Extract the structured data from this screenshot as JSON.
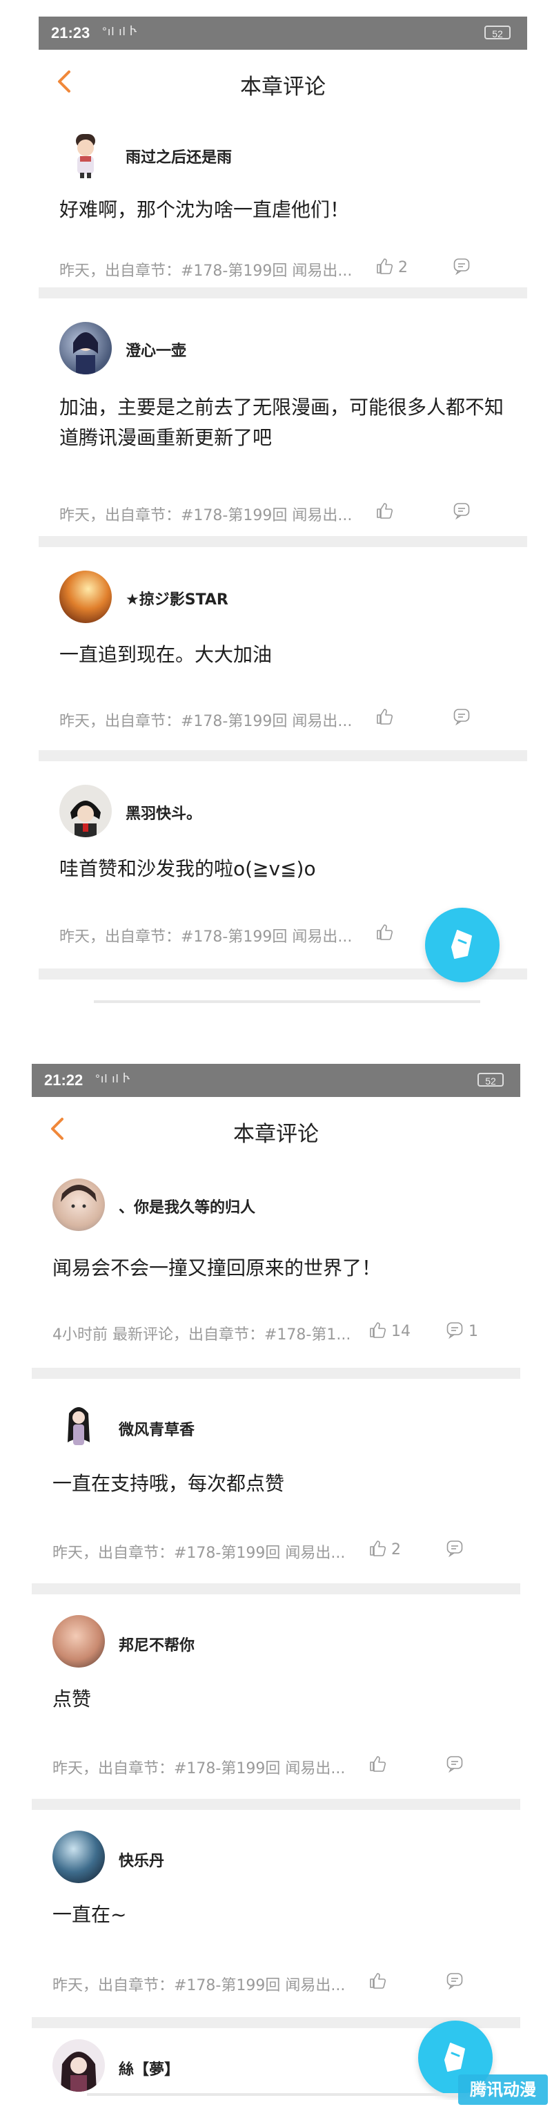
{
  "screens": [
    {
      "status": {
        "time": "21:23",
        "signal": "°ıl ıl Ⴡ",
        "battery": "52"
      },
      "header": {
        "title": "本章评论"
      },
      "comments": [
        {
          "user": "雨过之后还是雨",
          "text": "好难啊，那个沈为啥一直虐他们！",
          "meta": "昨天，出自章节：#178-第199回 闻易出...",
          "likes": "2",
          "replies": ""
        },
        {
          "user": "澄心一壶",
          "text": "加油，主要是之前去了无限漫画，可能很多人都不知道腾讯漫画重新更新了吧",
          "meta": "昨天，出自章节：#178-第199回 闻易出...",
          "likes": "",
          "replies": ""
        },
        {
          "user": "★掠ジ影STAR",
          "text": "一直追到现在。大大加油",
          "meta": "昨天，出自章节：#178-第199回 闻易出...",
          "likes": "",
          "replies": ""
        },
        {
          "user": "黑羽快斗。",
          "text": "哇首赞和沙发我的啦o(≧v≦)o",
          "meta": "昨天，出自章节：#178-第199回 闻易出...",
          "likes": "",
          "replies": ""
        }
      ]
    },
    {
      "status": {
        "time": "21:22",
        "signal": "°ıl ıl Ⴡ",
        "battery": "52"
      },
      "header": {
        "title": "本章评论"
      },
      "comments": [
        {
          "user": "、你是我久等的归人",
          "text": "闻易会不会一撞又撞回原来的世界了！",
          "meta": "4小时前 最新评论，出自章节：#178-第1...",
          "likes": "14",
          "replies": "1"
        },
        {
          "user": "微风青草香",
          "text": "一直在支持哦，每次都点赞",
          "meta": "昨天，出自章节：#178-第199回 闻易出...",
          "likes": "2",
          "replies": ""
        },
        {
          "user": "邦尼不帮你",
          "text": "点赞",
          "meta": "昨天，出自章节：#178-第199回 闻易出...",
          "likes": "",
          "replies": ""
        },
        {
          "user": "快乐丹",
          "text": "一直在~",
          "meta": "昨天，出自章节：#178-第199回 闻易出...",
          "likes": "",
          "replies": ""
        },
        {
          "user": "絲【夢】",
          "text": "",
          "meta": "",
          "likes": "",
          "replies": ""
        }
      ]
    }
  ],
  "icons": {
    "back": "chevron-left-icon",
    "like": "thumbs-up-icon",
    "reply": "comment-icon",
    "fab": "pen-icon"
  },
  "colors": {
    "accent_orange": "#f0883a",
    "fab_blue": "#2ec6ef",
    "meta_gray": "#9a9a9a",
    "separator": "#eeeeee",
    "statusbar": "#7a7a7a"
  },
  "watermark": "腾讯动漫"
}
